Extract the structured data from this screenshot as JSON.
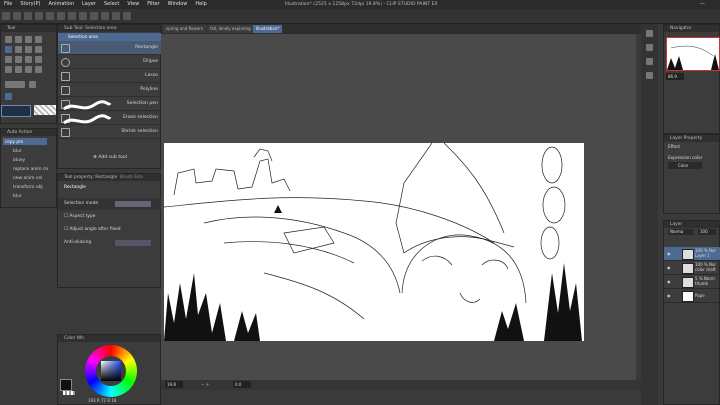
{
  "menubar": {
    "items": [
      "File",
      "Story(P)",
      "Animation",
      "Layer",
      "Select",
      "View",
      "Filter",
      "Window",
      "Help"
    ],
    "title": "Illustration* (2525 x 1258px 72dpi 19.8%) - CLIP STUDIO PAINT EX"
  },
  "tabs": [
    {
      "label": "spring and flowers"
    },
    {
      "label": "fall, lonely exploring"
    },
    {
      "label": "Illustration*"
    }
  ],
  "panels": {
    "tool": {
      "title": "Tool"
    },
    "sub_tool": {
      "title": "Sub Tool: Selection area",
      "group": "Selection area"
    },
    "tool_property": {
      "title": "Tool property: Rectangle",
      "tab2": "Brush Size"
    },
    "auto_action": {
      "title": "Auto Action"
    },
    "color_wheel": {
      "title": "Color Wh"
    },
    "navigator": {
      "title": "Navigator"
    },
    "layer_property": {
      "title": "Layer Property"
    },
    "layer": {
      "title": "Layer"
    }
  },
  "sub_tools": [
    {
      "label": "Rectangle",
      "selected": true
    },
    {
      "label": "Ellipse",
      "selected": false
    },
    {
      "label": "Lasso",
      "selected": false
    },
    {
      "label": "Polyline",
      "selected": false
    },
    {
      "label": "Selection pen",
      "selected": false
    },
    {
      "label": "Erase selection",
      "selected": false
    },
    {
      "label": "Shrink selection",
      "selected": false
    }
  ],
  "add_sub_tool": "Add sub tool",
  "tool_property": {
    "tool_name": "Rectangle",
    "rows": [
      "Selection mode",
      "Aspect type",
      "Adjust angle after fixed",
      "Anti-aliasing"
    ]
  },
  "auto_action": {
    "set": "copy pre",
    "items": [
      "blur",
      "bluey",
      "replace anim ce",
      "new anim cel",
      "transform obj",
      "blur"
    ]
  },
  "navigator": {
    "zoom": "86.9"
  },
  "layer_property": {
    "effect": "Effect",
    "expression_label": "Expression color",
    "expression_value": "Color"
  },
  "layer_panel": {
    "blend": "Norma",
    "opacity": "100"
  },
  "layers": [
    {
      "line1": "100 % Nor",
      "line2": "Layer 1",
      "selected": true
    },
    {
      "line1": "100 % Nor",
      "line2": "color draft",
      "selected": false
    },
    {
      "line1": "5 % Norm",
      "line2": "thumb",
      "selected": false
    },
    {
      "line1": "",
      "line2": "Pape",
      "selected": false
    }
  ],
  "status": {
    "zoom": "19.8",
    "angle": "0.0"
  },
  "color": {
    "values": "193 R 72 R 18"
  },
  "colors": {
    "accent": "#4d6a93",
    "panel": "#3c3c3c",
    "bg": "#3a3a3a"
  }
}
